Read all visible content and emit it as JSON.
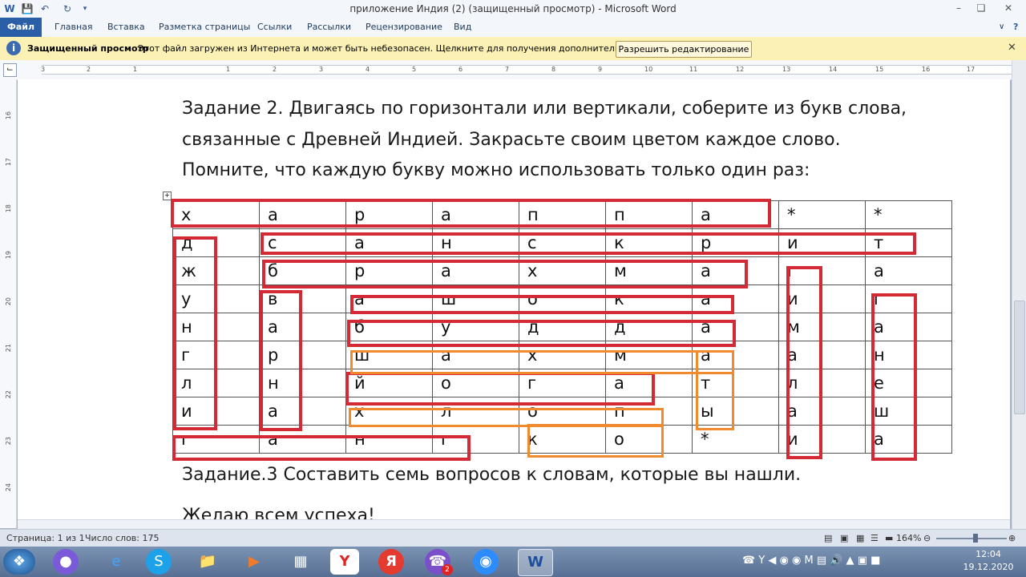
{
  "window": {
    "title": "приложение  Индия (2) (защищенный просмотр)  -  Microsoft Word"
  },
  "ribbon": {
    "tabs": [
      "Файл",
      "Главная",
      "Вставка",
      "Разметка страницы",
      "Ссылки",
      "Рассылки",
      "Рецензирование",
      "Вид"
    ]
  },
  "protected_view": {
    "title": "Защищенный просмотр",
    "message": "Этот файл загружен из Интернета и может быть небезопасен. Щелкните для получения дополнительных сведений.",
    "button": "Разрешить редактирование"
  },
  "ruler": {
    "numbers": [
      "3",
      "2",
      "1",
      "1",
      "2",
      "3",
      "4",
      "5",
      "6",
      "7",
      "8",
      "9",
      "10",
      "11",
      "12",
      "13",
      "14",
      "15",
      "16",
      "17"
    ],
    "vertical_numbers": [
      "16",
      "17",
      "18",
      "19",
      "20",
      "21",
      "22",
      "23",
      "24"
    ]
  },
  "document": {
    "line1": "Задание 2. Двигаясь по горизонтали или вертикали, соберите из букв слова,",
    "line2": "связанные с Древней Индией. Закрасьте своим цветом каждое слово.",
    "line3": "Помните, что каждую букву можно использовать только один раз:",
    "grid": [
      [
        "х",
        "а",
        "р",
        "а",
        "п",
        "п",
        "а",
        "*",
        "*"
      ],
      [
        "д",
        "с",
        "а",
        "н",
        "с",
        "к",
        "р",
        "и",
        "т"
      ],
      [
        "ж",
        "б",
        "р",
        "а",
        "х",
        "м",
        "а",
        "г",
        "а"
      ],
      [
        "у",
        "в",
        "а",
        "ш",
        "о",
        "к",
        "а",
        "и",
        "г"
      ],
      [
        "н",
        "а",
        "б",
        "у",
        "д",
        "д",
        "а",
        "м",
        "а"
      ],
      [
        "г",
        "р",
        "ш",
        "а",
        "х",
        "м",
        "а",
        "а",
        "н"
      ],
      [
        "л",
        "н",
        "й",
        "о",
        "г",
        "а",
        "т",
        "л",
        "е"
      ],
      [
        "и",
        "а",
        "х",
        "л",
        "о",
        "п",
        "ы",
        "а",
        "ш"
      ],
      [
        "г",
        "а",
        "н",
        "г",
        "к",
        "о",
        "*",
        "и",
        "а"
      ]
    ],
    "task3": "Задание.3  Составить  семь  вопросов к словам, которые вы нашли.",
    "wish": "Желаю всем успеха!"
  },
  "statusbar": {
    "page": "Страница: 1 из 1",
    "words": "Число слов: 175",
    "zoom": "164%"
  },
  "taskbar": {
    "time": "12:04",
    "date": "19.12.2020",
    "viber_badge": "2"
  },
  "colors": {
    "word_box": "#d42a36",
    "alt_box": "#f08a2c",
    "file_tab": "#2a5fa8"
  }
}
